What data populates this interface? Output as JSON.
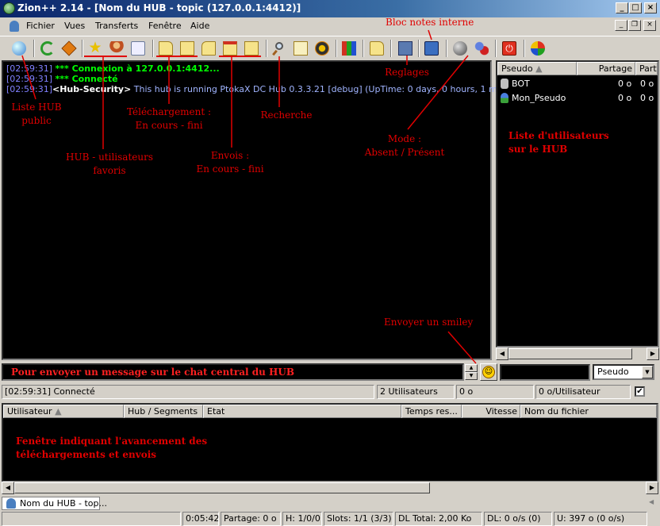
{
  "window": {
    "title": "Zion++ 2.14 - [Nom du HUB - topic (127.0.0.1:4412)]"
  },
  "menu": {
    "items": [
      "Fichier",
      "Vues",
      "Transferts",
      "Fenêtre",
      "Aide"
    ]
  },
  "toolbar": {
    "icons": [
      "public-hubs-icon",
      "reconnect-icon",
      "follow-redirect-icon",
      "favorite-hubs-icon",
      "favorite-users-icon",
      "waiting-users-icon",
      "downloads-queue-icon",
      "finished-downloads-icon",
      "upload-queue-icon",
      "uploads-icon",
      "finished-uploads-icon",
      "search-icon",
      "adl-search-icon",
      "search-spy-icon",
      "network-stats-icon",
      "open-folder-icon",
      "settings-icon",
      "notepad-icon",
      "away-icon",
      "away-users-icon",
      "shutdown-icon",
      "hash-progress-icon"
    ]
  },
  "chat": {
    "lines": [
      {
        "time": "[02:59:31]",
        "text": "*** Connexion à 127.0.0.1:4412..."
      },
      {
        "time": "[02:59:31]",
        "text": "*** Connecté"
      },
      {
        "time": "[02:59:31]",
        "nick": "<Hub-Security>",
        "text": " This hub is running PtokaX DC Hub 0.3.3.21 [debug] (UpTime: 0 days, 0 hours, 1 minutes)"
      }
    ]
  },
  "userlist": {
    "columns": [
      "Pseudo",
      "Partage",
      "Parta"
    ],
    "users": [
      {
        "nick": "BOT",
        "share": "0 o",
        "share2": "0 o"
      },
      {
        "nick": "Mon_Pseudo",
        "share": "0 o",
        "share2": "0 o"
      }
    ]
  },
  "message": {
    "value": "Pour envoyer un message sur le chat central du HUB"
  },
  "filter": {
    "selected": "Pseudo"
  },
  "hub_status": {
    "log": "[02:59:31] Connecté",
    "users": "2 Utilisateurs",
    "share": "0 o",
    "per_user": "0 o/Utilisateur"
  },
  "transfers": {
    "columns": [
      "Utilisateur",
      "Hub / Segments",
      "Etat",
      "Temps res...",
      "Vitesse",
      "Nom du fichier"
    ]
  },
  "tab": {
    "label": "Nom du HUB - top..."
  },
  "statusbar": {
    "time": "0:05:42",
    "partage": "Partage: 0 o",
    "hubs": "H: 1/0/0",
    "slots": "Slots: 1/1 (3/3)",
    "dl_total": "DL Total: 2,00 Ko",
    "dl": "DL: 0 o/s (0)",
    "ul": "U: 397 o (0 o/s)"
  },
  "annotations": {
    "liste_hub": "Liste HUB\npublic",
    "hub_fav": "HUB - utilisateurs\nfavoris",
    "telechargement": "Téléchargement :\nEn cours - fini",
    "envois": "Envois :\nEn cours - fini",
    "recherche": "Recherche",
    "bloc_notes": "Bloc notes interne",
    "reglages": "Reglages",
    "mode": "Mode :\nAbsent / Présent",
    "liste_users": "Liste d'utilisateurs\nsur le HUB",
    "smiley": "Envoyer un smiley",
    "fenetre": "Fenêtre indiquant l'avancement des\ntéléchargements et envois"
  },
  "colors": {
    "annotation": "#e00000",
    "chat_green": "#00ff00",
    "timestamp": "#8080ff",
    "titlebar": "#0a246a"
  }
}
